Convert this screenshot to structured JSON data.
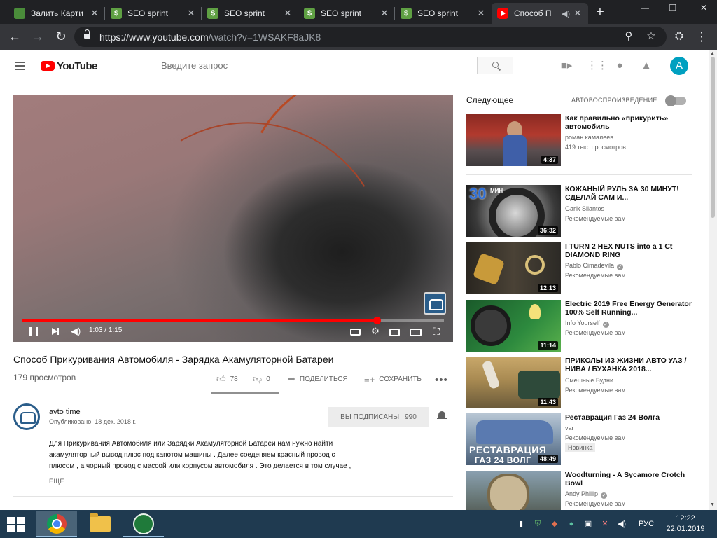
{
  "browser": {
    "tabs": [
      {
        "title": "Залить Карти",
        "favicon": "picture-icon"
      },
      {
        "title": "SEO sprint",
        "favicon": "seo-sprint-icon"
      },
      {
        "title": "SEO sprint",
        "favicon": "seo-sprint-icon"
      },
      {
        "title": "SEO sprint",
        "favicon": "seo-sprint-icon"
      },
      {
        "title": "SEO sprint",
        "favicon": "seo-sprint-icon"
      },
      {
        "title": "Способ П",
        "favicon": "youtube-icon",
        "active": true,
        "audio": true
      }
    ],
    "url_host": "https://www.youtube.com",
    "url_path": "/watch?v=1WSAKF8aJK8"
  },
  "youtube": {
    "logo_text": "YouTube",
    "search_placeholder": "Введите запрос",
    "avatar_letter": "A",
    "accent_color": "#ff0000"
  },
  "video": {
    "current_time": "1:03",
    "duration": "1:15",
    "progress": 0.84,
    "title": "Способ Прикуривания Автомобиля - Зарядка Акамуляторной Батареи",
    "views": "179 просмотров",
    "likes": "78",
    "dislikes": "0",
    "share_label": "ПОДЕЛИТЬСЯ",
    "save_label": "СОХРАНИТЬ",
    "more_label": "•••"
  },
  "channel": {
    "name": "avto time",
    "published": "Опубликовано: 18 дек. 2018 г.",
    "subscribe_label": "ВЫ ПОДПИСАНЫ",
    "subscribers": "990",
    "description_lines": [
      "Для  Прикуривания Автомобиля или  Зарядки Акамуляторной Батареи нам нужно найти",
      "акамуляторный вывод плюс под капотом машины . Далее соеденяем красный провод с",
      "плюсом , а чорный провод с массой или корпусом автомобиля . Это делается в том случае ,"
    ],
    "more_label": "ЕЩЁ"
  },
  "sidebar": {
    "up_next_label": "Следующее",
    "autoplay_label": "АВТОВОСПРОИЗВЕДЕНИЕ",
    "videos": [
      {
        "title": "Как правильно «прикурить» автомобиль",
        "channel": "роман камалеев",
        "meta": "419 тыс. просмотров",
        "duration": "4:37",
        "verified": false
      },
      {
        "title": "КОЖАНЫЙ РУЛЬ ЗА 30 МИНУТ! СДЕЛАЙ САМ И...",
        "channel": "Garik Silantos",
        "meta": "Рекомендуемые вам",
        "duration": "36:32",
        "verified": false,
        "thumb_text_1": "30",
        "thumb_text_2": "МИН"
      },
      {
        "title": "I TURN 2 HEX NUTS into a 1 Ct DIAMOND RING",
        "channel": "Pablo Cimadevila",
        "meta": "Рекомендуемые вам",
        "duration": "12:13",
        "verified": true
      },
      {
        "title": "Electric 2019 Free Energy Generator 100% Self Running...",
        "channel": "Info Yourself",
        "meta": "Рекомендуемые вам",
        "duration": "11:14",
        "verified": true
      },
      {
        "title": "ПРИКОЛЫ ИЗ ЖИЗНИ АВТО УАЗ / НИВА / БУХАНКА 2018...",
        "channel": "Смешные Будни",
        "meta": "Рекомендуемые вам",
        "duration": "11:43",
        "verified": false
      },
      {
        "title": "Реставрация Газ 24 Волга",
        "channel": "var",
        "meta": "Рекомендуемые вам",
        "duration": "48:49",
        "verified": false,
        "badge": "Новинка",
        "thumb_text_1": "РЕСТАВРАЦИЯ",
        "thumb_text_2": "ГАЗ 24 ВОЛГ"
      },
      {
        "title": "Woodturning - A Sycamore Crotch Bowl",
        "channel": "Andy Phillip",
        "meta": "Рекомендуемые вам",
        "duration": "",
        "verified": true
      }
    ]
  },
  "taskbar": {
    "language": "РУС",
    "time": "12:22",
    "date": "22.01.2019"
  }
}
